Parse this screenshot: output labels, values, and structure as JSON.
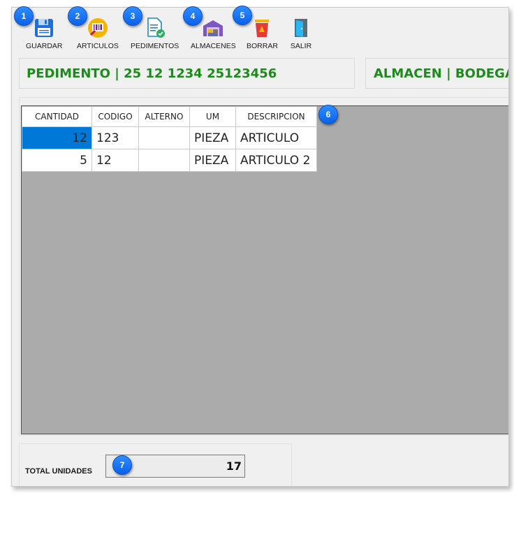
{
  "toolbar": [
    {
      "label": "GUARDAR",
      "icon": "floppy-disk-icon"
    },
    {
      "label": "ARTICULOS",
      "icon": "barcode-icon"
    },
    {
      "label": "PEDIMENTOS",
      "icon": "document-check-icon"
    },
    {
      "label": "ALMACENES",
      "icon": "warehouse-icon"
    },
    {
      "label": "BORRAR",
      "icon": "trash-icon"
    },
    {
      "label": "SALIR",
      "icon": "exit-door-icon"
    }
  ],
  "header": {
    "pedimento": "PEDIMENTO | 25  12  1234  25123456",
    "almacen": "ALMACEN | BODEGA"
  },
  "grid": {
    "columns": [
      "CANTIDAD",
      "CODIGO",
      "ALTERNO",
      "UM",
      "DESCRIPCION"
    ],
    "rows": [
      {
        "cantidad": "12",
        "codigo": "123",
        "alterno": "",
        "um": "PIEZA",
        "descripcion": "ARTICULO"
      },
      {
        "cantidad": "5",
        "codigo": "12",
        "alterno": "",
        "um": "PIEZA",
        "descripcion": "ARTICULO 2"
      }
    ]
  },
  "footer": {
    "total_label": "TOTAL UNIDADES",
    "total_value": "17"
  },
  "callouts": [
    "1",
    "2",
    "3",
    "4",
    "5",
    "6",
    "7"
  ],
  "colors": {
    "header_text": "#1e8a1e",
    "selection": "#0078d7",
    "grid_background": "#ababab",
    "callout": "#0a62e8"
  }
}
